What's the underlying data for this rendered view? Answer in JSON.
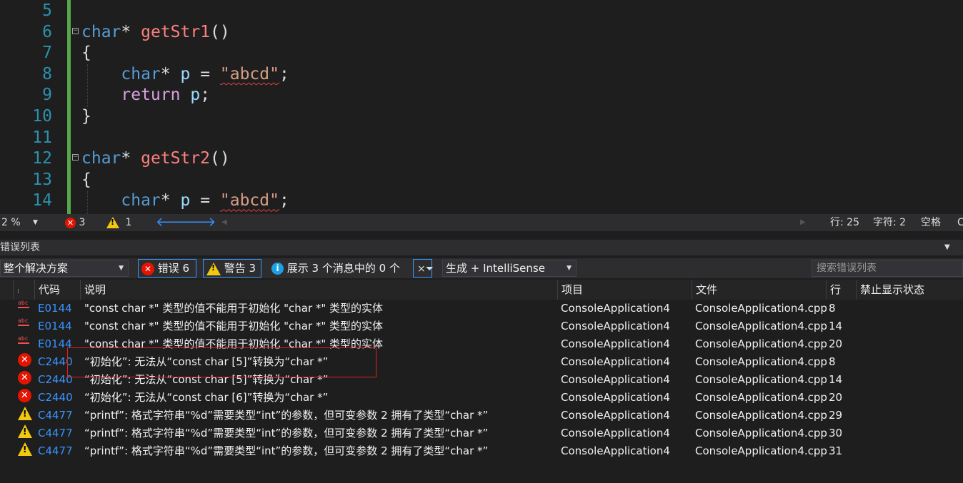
{
  "editor": {
    "lines": [
      {
        "num": "5",
        "tokens": []
      },
      {
        "num": "6",
        "fold": true,
        "tokens": [
          {
            "t": "char",
            "c": "kw"
          },
          {
            "t": "* ",
            "c": "plain"
          },
          {
            "t": "getStr1",
            "c": "fn"
          },
          {
            "t": "()",
            "c": "plain"
          }
        ]
      },
      {
        "num": "7",
        "tokens": [
          {
            "t": "{",
            "c": "plain"
          }
        ]
      },
      {
        "num": "8",
        "tokens": [
          {
            "t": "    ",
            "c": "plain"
          },
          {
            "t": "char",
            "c": "kw"
          },
          {
            "t": "* ",
            "c": "plain"
          },
          {
            "t": "p",
            "c": "var"
          },
          {
            "t": " = ",
            "c": "plain"
          },
          {
            "t": "\"abcd\"",
            "c": "str"
          },
          {
            "t": ";",
            "c": "plain"
          }
        ]
      },
      {
        "num": "9",
        "tokens": [
          {
            "t": "    ",
            "c": "plain"
          },
          {
            "t": "return",
            "c": "ret"
          },
          {
            "t": " ",
            "c": "plain"
          },
          {
            "t": "p",
            "c": "var"
          },
          {
            "t": ";",
            "c": "plain"
          }
        ]
      },
      {
        "num": "10",
        "tokens": [
          {
            "t": "}",
            "c": "plain"
          }
        ]
      },
      {
        "num": "11",
        "tokens": []
      },
      {
        "num": "12",
        "fold": true,
        "tokens": [
          {
            "t": "char",
            "c": "kw"
          },
          {
            "t": "* ",
            "c": "plain"
          },
          {
            "t": "getStr2",
            "c": "fn"
          },
          {
            "t": "()",
            "c": "plain"
          }
        ]
      },
      {
        "num": "13",
        "tokens": [
          {
            "t": "{",
            "c": "plain"
          }
        ]
      },
      {
        "num": "14",
        "tokens": [
          {
            "t": "    ",
            "c": "plain"
          },
          {
            "t": "char",
            "c": "kw"
          },
          {
            "t": "* ",
            "c": "plain"
          },
          {
            "t": "p",
            "c": "var"
          },
          {
            "t": " = ",
            "c": "plain"
          },
          {
            "t": "\"abcd\"",
            "c": "str"
          },
          {
            "t": ";",
            "c": "plain"
          }
        ]
      }
    ]
  },
  "status": {
    "zoom": "2 %",
    "error_count": "3",
    "warning_count": "1",
    "line": "行: 25",
    "char": "字符: 2",
    "mode": "空格",
    "extra": "C"
  },
  "panel": {
    "title": "错误列表",
    "scope": "整个解决方案",
    "errors_btn": "错误 6",
    "warnings_btn": "警告 3",
    "messages_btn": "展示 3 个消息中的 0 个",
    "build_filter": "生成 + IntelliSense",
    "search_placeholder": "搜索错误列表"
  },
  "columns": {
    "code": "代码",
    "desc": "说明",
    "project": "项目",
    "file": "文件",
    "line": "行",
    "suppress": "禁止显示状态"
  },
  "rows": [
    {
      "icon": "abc",
      "code": "E0144",
      "desc": "\"const char *\" 类型的值不能用于初始化 \"char *\" 类型的实体",
      "project": "ConsoleApplication4",
      "file": "ConsoleApplication4.cpp",
      "line": "8"
    },
    {
      "icon": "abc",
      "code": "E0144",
      "desc": "\"const char *\" 类型的值不能用于初始化 \"char *\" 类型的实体",
      "project": "ConsoleApplication4",
      "file": "ConsoleApplication4.cpp",
      "line": "14"
    },
    {
      "icon": "abc",
      "code": "E0144",
      "desc": "\"const char *\" 类型的值不能用于初始化 \"char *\" 类型的实体",
      "project": "ConsoleApplication4",
      "file": "ConsoleApplication4.cpp",
      "line": "20"
    },
    {
      "icon": "error",
      "code": "C2440",
      "desc": "“初始化”: 无法从“const char [5]”转换为“char *”",
      "project": "ConsoleApplication4",
      "file": "ConsoleApplication4.cpp",
      "line": "8"
    },
    {
      "icon": "error",
      "code": "C2440",
      "desc": "“初始化”: 无法从“const char [5]”转换为“char *”",
      "project": "ConsoleApplication4",
      "file": "ConsoleApplication4.cpp",
      "line": "14"
    },
    {
      "icon": "error",
      "code": "C2440",
      "desc": "“初始化”: 无法从“const char [6]”转换为“char *”",
      "project": "ConsoleApplication4",
      "file": "ConsoleApplication4.cpp",
      "line": "20"
    },
    {
      "icon": "warning",
      "code": "C4477",
      "desc": "“printf”: 格式字符串“%d”需要类型“int”的参数，但可变参数 2 拥有了类型“char *”",
      "project": "ConsoleApplication4",
      "file": "ConsoleApplication4.cpp",
      "line": "29"
    },
    {
      "icon": "warning",
      "code": "C4477",
      "desc": "“printf”: 格式字符串“%d”需要类型“int”的参数，但可变参数 2 拥有了类型“char *”",
      "project": "ConsoleApplication4",
      "file": "ConsoleApplication4.cpp",
      "line": "30"
    },
    {
      "icon": "warning",
      "code": "C4477",
      "desc": "“printf”: 格式字符串“%d”需要类型“int”的参数，但可变参数 2 拥有了类型“char *”",
      "project": "ConsoleApplication4",
      "file": "ConsoleApplication4.cpp",
      "line": "31"
    }
  ]
}
